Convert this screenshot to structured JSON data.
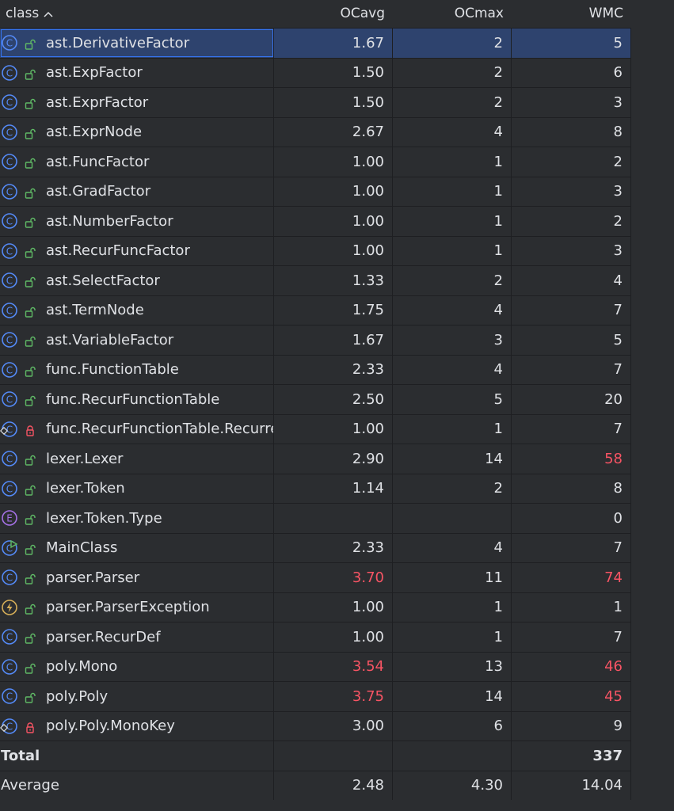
{
  "columns": [
    {
      "label": "class",
      "sort_icon": "chevron-up-icon"
    },
    {
      "label": "OCavg"
    },
    {
      "label": "OCmax"
    },
    {
      "label": "WMC"
    }
  ],
  "rows": [
    {
      "icon": "class-icon",
      "lock": "open-lock-icon",
      "name": "ast.DerivativeFactor",
      "ocavg": "1.67",
      "ocmax": "2",
      "wmc": "5",
      "selected": true
    },
    {
      "icon": "class-icon",
      "lock": "open-lock-icon",
      "name": "ast.ExpFactor",
      "ocavg": "1.50",
      "ocmax": "2",
      "wmc": "6"
    },
    {
      "icon": "class-icon",
      "lock": "open-lock-icon",
      "name": "ast.ExprFactor",
      "ocavg": "1.50",
      "ocmax": "2",
      "wmc": "3"
    },
    {
      "icon": "class-icon",
      "lock": "open-lock-icon",
      "name": "ast.ExprNode",
      "ocavg": "2.67",
      "ocmax": "4",
      "wmc": "8"
    },
    {
      "icon": "class-icon",
      "lock": "open-lock-icon",
      "name": "ast.FuncFactor",
      "ocavg": "1.00",
      "ocmax": "1",
      "wmc": "2"
    },
    {
      "icon": "class-icon",
      "lock": "open-lock-icon",
      "name": "ast.GradFactor",
      "ocavg": "1.00",
      "ocmax": "1",
      "wmc": "3"
    },
    {
      "icon": "class-icon",
      "lock": "open-lock-icon",
      "name": "ast.NumberFactor",
      "ocavg": "1.00",
      "ocmax": "1",
      "wmc": "2"
    },
    {
      "icon": "class-icon",
      "lock": "open-lock-icon",
      "name": "ast.RecurFuncFactor",
      "ocavg": "1.00",
      "ocmax": "1",
      "wmc": "3"
    },
    {
      "icon": "class-icon",
      "lock": "open-lock-icon",
      "name": "ast.SelectFactor",
      "ocavg": "1.33",
      "ocmax": "2",
      "wmc": "4"
    },
    {
      "icon": "class-icon",
      "lock": "open-lock-icon",
      "name": "ast.TermNode",
      "ocavg": "1.75",
      "ocmax": "4",
      "wmc": "7"
    },
    {
      "icon": "class-icon",
      "lock": "open-lock-icon",
      "name": "ast.VariableFactor",
      "ocavg": "1.67",
      "ocmax": "3",
      "wmc": "5"
    },
    {
      "icon": "class-icon",
      "lock": "open-lock-icon",
      "name": "func.FunctionTable",
      "ocavg": "2.33",
      "ocmax": "4",
      "wmc": "7"
    },
    {
      "icon": "class-icon",
      "lock": "open-lock-icon",
      "name": "func.RecurFunctionTable",
      "ocavg": "2.50",
      "ocmax": "5",
      "wmc": "20"
    },
    {
      "icon": "inner-class-icon",
      "lock": "closed-lock-icon",
      "name": "func.RecurFunctionTable.Recurrer",
      "ocavg": "1.00",
      "ocmax": "1",
      "wmc": "7"
    },
    {
      "icon": "class-icon",
      "lock": "open-lock-icon",
      "name": "lexer.Lexer",
      "ocavg": "2.90",
      "ocmax": "14",
      "wmc": "58",
      "wmc_red": true
    },
    {
      "icon": "class-icon",
      "lock": "open-lock-icon",
      "name": "lexer.Token",
      "ocavg": "1.14",
      "ocmax": "2",
      "wmc": "8"
    },
    {
      "icon": "enum-icon",
      "lock": "open-lock-icon",
      "name": "lexer.Token.Type",
      "ocavg": "",
      "ocmax": "",
      "wmc": "0"
    },
    {
      "icon": "main-class-icon",
      "lock": "open-lock-icon",
      "name": "MainClass",
      "ocavg": "2.33",
      "ocmax": "4",
      "wmc": "7"
    },
    {
      "icon": "class-icon",
      "lock": "open-lock-icon",
      "name": "parser.Parser",
      "ocavg": "3.70",
      "ocmax": "11",
      "wmc": "74",
      "ocavg_red": true,
      "wmc_red": true
    },
    {
      "icon": "exception-icon",
      "lock": "open-lock-icon",
      "name": "parser.ParserException",
      "ocavg": "1.00",
      "ocmax": "1",
      "wmc": "1"
    },
    {
      "icon": "class-icon",
      "lock": "open-lock-icon",
      "name": "parser.RecurDef",
      "ocavg": "1.00",
      "ocmax": "1",
      "wmc": "7"
    },
    {
      "icon": "class-icon",
      "lock": "open-lock-icon",
      "name": "poly.Mono",
      "ocavg": "3.54",
      "ocmax": "13",
      "wmc": "46",
      "ocavg_red": true,
      "wmc_red": true
    },
    {
      "icon": "class-icon",
      "lock": "open-lock-icon",
      "name": "poly.Poly",
      "ocavg": "3.75",
      "ocmax": "14",
      "wmc": "45",
      "ocavg_red": true,
      "wmc_red": true
    },
    {
      "icon": "inner-class-icon",
      "lock": "closed-lock-icon",
      "name": "poly.Poly.MonoKey",
      "ocavg": "3.00",
      "ocmax": "6",
      "wmc": "9"
    }
  ],
  "total": {
    "label": "Total",
    "ocavg": "",
    "ocmax": "",
    "wmc": "337"
  },
  "average": {
    "label": "Average",
    "ocavg": "2.48",
    "ocmax": "4.30",
    "wmc": "14.04"
  },
  "colors": {
    "background": "#2b2d30",
    "selected_row": "#2e436e",
    "selection_border": "#3574f0",
    "text": "#dfe1e5",
    "warning_red": "#f75464",
    "class_icon": "#548af7",
    "enum_icon": "#a571e6",
    "exception_icon": "#d6ae58",
    "open_lock": "#5fb865",
    "closed_lock": "#f75464"
  }
}
